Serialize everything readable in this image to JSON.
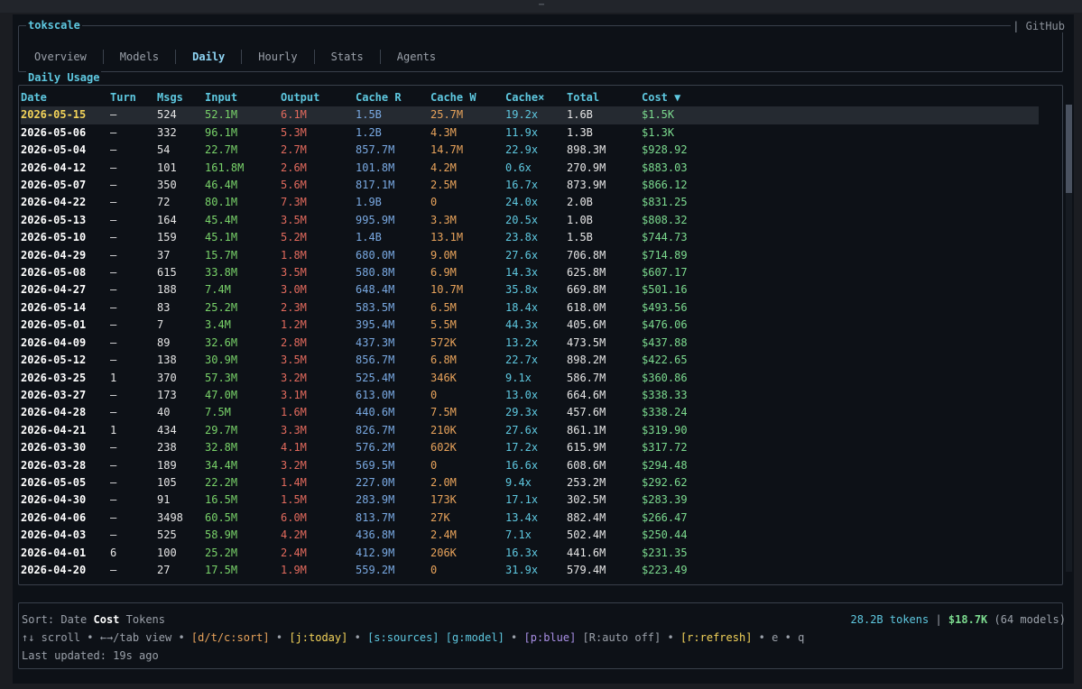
{
  "window": {
    "grip": "⋯"
  },
  "app": {
    "title": "tokscale",
    "github": "| GitHub"
  },
  "tabs": [
    {
      "label": "Overview",
      "active": false
    },
    {
      "label": "Models",
      "active": false
    },
    {
      "label": "Daily",
      "active": true
    },
    {
      "label": "Hourly",
      "active": false
    },
    {
      "label": "Stats",
      "active": false
    },
    {
      "label": "Agents",
      "active": false
    }
  ],
  "daily": {
    "title": "Daily Usage",
    "columns": [
      "Date",
      "Turn",
      "Msgs",
      "Input",
      "Output",
      "Cache R",
      "Cache W",
      "Cache×",
      "Total",
      "Cost ▼"
    ],
    "rows": [
      [
        "2026-05-15",
        "—",
        "524",
        "52.1M",
        "6.1M",
        "1.5B",
        "25.7M",
        "19.2x",
        "1.6B",
        "$1.5K"
      ],
      [
        "2026-05-06",
        "—",
        "332",
        "96.1M",
        "5.3M",
        "1.2B",
        "4.3M",
        "11.9x",
        "1.3B",
        "$1.3K"
      ],
      [
        "2026-05-04",
        "—",
        "54",
        "22.7M",
        "2.7M",
        "857.7M",
        "14.7M",
        "22.9x",
        "898.3M",
        "$928.92"
      ],
      [
        "2026-04-12",
        "—",
        "101",
        "161.8M",
        "2.6M",
        "101.8M",
        "4.2M",
        "0.6x",
        "270.9M",
        "$883.03"
      ],
      [
        "2026-05-07",
        "—",
        "350",
        "46.4M",
        "5.6M",
        "817.1M",
        "2.5M",
        "16.7x",
        "873.9M",
        "$866.12"
      ],
      [
        "2026-04-22",
        "—",
        "72",
        "80.1M",
        "7.3M",
        "1.9B",
        "0",
        "24.0x",
        "2.0B",
        "$831.25"
      ],
      [
        "2026-05-13",
        "—",
        "164",
        "45.4M",
        "3.5M",
        "995.9M",
        "3.3M",
        "20.5x",
        "1.0B",
        "$808.32"
      ],
      [
        "2026-05-10",
        "—",
        "159",
        "45.1M",
        "5.2M",
        "1.4B",
        "13.1M",
        "23.8x",
        "1.5B",
        "$744.73"
      ],
      [
        "2026-04-29",
        "—",
        "37",
        "15.7M",
        "1.8M",
        "680.0M",
        "9.0M",
        "27.6x",
        "706.8M",
        "$714.89"
      ],
      [
        "2026-05-08",
        "—",
        "615",
        "33.8M",
        "3.5M",
        "580.8M",
        "6.9M",
        "14.3x",
        "625.8M",
        "$607.17"
      ],
      [
        "2026-04-27",
        "—",
        "188",
        "7.4M",
        "3.0M",
        "648.4M",
        "10.7M",
        "35.8x",
        "669.8M",
        "$501.16"
      ],
      [
        "2026-05-14",
        "—",
        "83",
        "25.2M",
        "2.3M",
        "583.5M",
        "6.5M",
        "18.4x",
        "618.0M",
        "$493.56"
      ],
      [
        "2026-05-01",
        "—",
        "7",
        "3.4M",
        "1.2M",
        "395.4M",
        "5.5M",
        "44.3x",
        "405.6M",
        "$476.06"
      ],
      [
        "2026-04-09",
        "—",
        "89",
        "32.6M",
        "2.8M",
        "437.3M",
        "572K",
        "13.2x",
        "473.5M",
        "$437.88"
      ],
      [
        "2026-05-12",
        "—",
        "138",
        "30.9M",
        "3.5M",
        "856.7M",
        "6.8M",
        "22.7x",
        "898.2M",
        "$422.65"
      ],
      [
        "2026-03-25",
        "1",
        "370",
        "57.3M",
        "3.2M",
        "525.4M",
        "346K",
        "9.1x",
        "586.7M",
        "$360.86"
      ],
      [
        "2026-03-27",
        "—",
        "173",
        "47.0M",
        "3.1M",
        "613.0M",
        "0",
        "13.0x",
        "664.6M",
        "$338.33"
      ],
      [
        "2026-04-28",
        "—",
        "40",
        "7.5M",
        "1.6M",
        "440.6M",
        "7.5M",
        "29.3x",
        "457.6M",
        "$338.24"
      ],
      [
        "2026-04-21",
        "1",
        "434",
        "29.7M",
        "3.3M",
        "826.7M",
        "210K",
        "27.6x",
        "861.1M",
        "$319.90"
      ],
      [
        "2026-03-30",
        "—",
        "238",
        "32.8M",
        "4.1M",
        "576.2M",
        "602K",
        "17.2x",
        "615.9M",
        "$317.72"
      ],
      [
        "2026-03-28",
        "—",
        "189",
        "34.4M",
        "3.2M",
        "569.5M",
        "0",
        "16.6x",
        "608.6M",
        "$294.48"
      ],
      [
        "2026-05-05",
        "—",
        "105",
        "22.2M",
        "1.4M",
        "227.0M",
        "2.0M",
        "9.4x",
        "253.2M",
        "$292.62"
      ],
      [
        "2026-04-30",
        "—",
        "91",
        "16.5M",
        "1.5M",
        "283.9M",
        "173K",
        "17.1x",
        "302.5M",
        "$283.39"
      ],
      [
        "2026-04-06",
        "—",
        "3498",
        "60.5M",
        "6.0M",
        "813.7M",
        "27K",
        "13.4x",
        "882.4M",
        "$266.47"
      ],
      [
        "2026-04-03",
        "—",
        "525",
        "58.9M",
        "4.2M",
        "436.8M",
        "2.4M",
        "7.1x",
        "502.4M",
        "$250.44"
      ],
      [
        "2026-04-01",
        "6",
        "100",
        "25.2M",
        "2.4M",
        "412.9M",
        "206K",
        "16.3x",
        "441.6M",
        "$231.35"
      ],
      [
        "2026-04-20",
        "—",
        "27",
        "17.5M",
        "1.9M",
        "559.2M",
        "0",
        "31.9x",
        "579.4M",
        "$223.49"
      ]
    ]
  },
  "footer": {
    "sort_label": "Sort:",
    "sort_date": "Date",
    "sort_cost": "Cost",
    "sort_tokens": "Tokens",
    "totals_tokens": "28.2B tokens",
    "totals_sep": "|",
    "totals_cost": "$18.7K",
    "totals_models": "(64 models)",
    "keys": {
      "scroll": "↑↓ scroll",
      "tabview": "←→/tab view",
      "sort": "[d/t/c:sort]",
      "today": "[j:today]",
      "sources": "[s:sources]",
      "model": "[g:model]",
      "blue": "[p:blue]",
      "auto": "[R:auto off]",
      "refresh": "[r:refresh]",
      "e": "e",
      "q": "q"
    },
    "last_updated": "Last updated: 19s ago"
  }
}
